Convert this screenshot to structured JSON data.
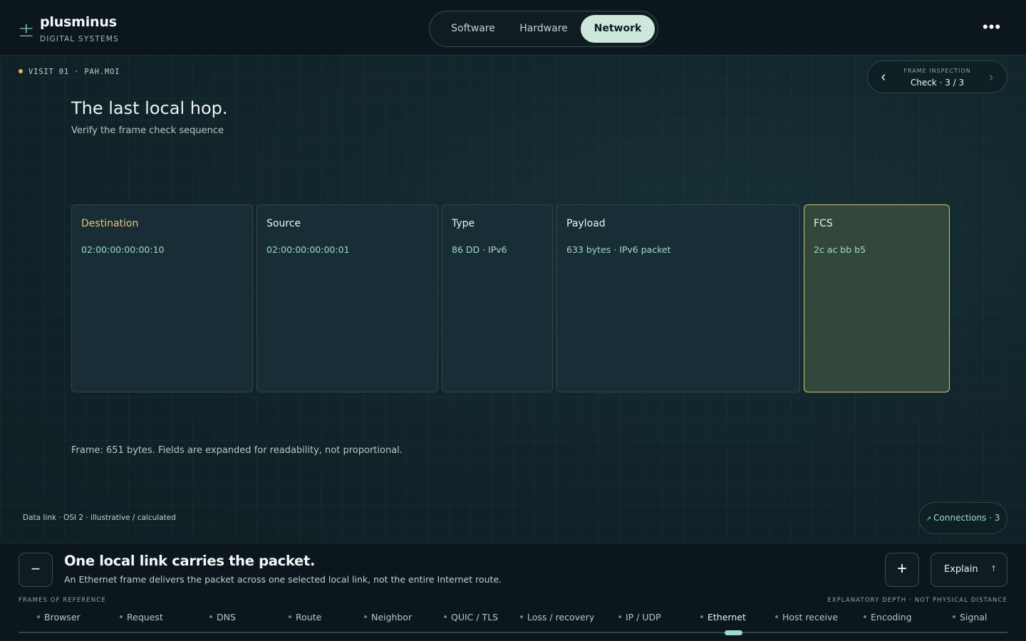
{
  "header": {
    "logo_glyph": "±",
    "brand_name": "plusminus",
    "brand_sub": "DIGITAL SYSTEMS",
    "tabs": [
      {
        "label": "Software",
        "active": false
      },
      {
        "label": "Hardware",
        "active": false
      },
      {
        "label": "Network",
        "active": true
      }
    ],
    "more_glyph": "•••"
  },
  "stage": {
    "visit": "VISIT 01 · PAH.MOI",
    "inspection": {
      "label": "FRAME INSPECTION",
      "value": "Check · 3 / 3",
      "prev_glyph": "‹",
      "next_glyph": "›"
    },
    "title": "The last local hop.",
    "subtitle": "Verify the frame check sequence",
    "fields": [
      {
        "name": "Destination",
        "value": "02:00:00:00:00:10"
      },
      {
        "name": "Source",
        "value": "02:00:00:00:00:01"
      },
      {
        "name": "Type",
        "value": "86 DD · IPv6"
      },
      {
        "name": "Payload",
        "value": "633 bytes · IPv6 packet"
      },
      {
        "name": "FCS",
        "value": "2c ac bb b5",
        "highlighted": true
      }
    ],
    "frame_note": "Frame: 651 bytes. Fields are expanded for readability, not proportional.",
    "layer_note": "Data link · OSI 2 · illustrative / calculated",
    "connections": {
      "arrow": "↗",
      "label": "Connections · 3"
    }
  },
  "bottom": {
    "minus_glyph": "−",
    "plus_glyph": "+",
    "claim": "One local link carries the packet.",
    "claim_sub": "An Ethernet frame delivers the packet across one selected local link, not the entire Internet route.",
    "explain": {
      "label": "Explain",
      "arrow": "↑"
    },
    "frames_label": "FRAMES OF REFERENCE",
    "depth_label": "EXPLANATORY DEPTH · NOT PHYSICAL DISTANCE",
    "frames": [
      "Browser",
      "Request",
      "DNS",
      "Route",
      "Neighbor",
      "QUIC / TLS",
      "Loss / recovery",
      "IP / UDP",
      "Ethernet",
      "Host receive",
      "Encoding",
      "Signal"
    ],
    "active_frame": "Ethernet"
  },
  "colors": {
    "accent": "#9fdcc4",
    "highlight_border": "#d6c07a",
    "destination_label": "#f0c27a",
    "visit_dot": "#e5b563"
  }
}
